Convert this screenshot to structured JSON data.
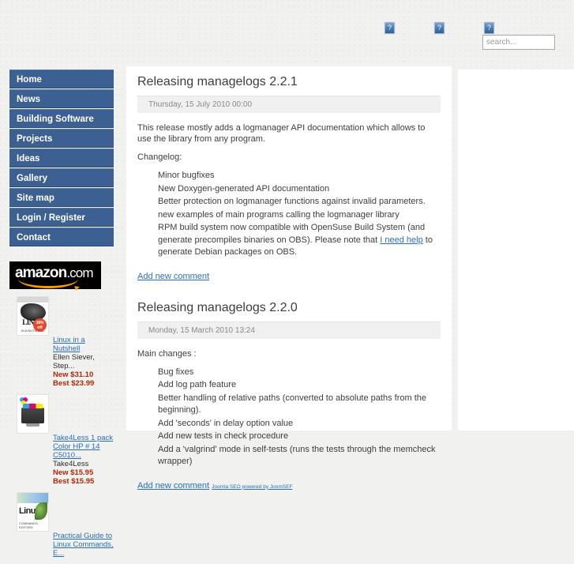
{
  "header": {
    "broken_images": [
      {
        "name": "broken-image-icon-1",
        "glyph": "?"
      },
      {
        "name": "broken-image-icon-2",
        "glyph": "?"
      },
      {
        "name": "broken-image-icon-3",
        "glyph": "?"
      }
    ],
    "search": {
      "placeholder": "search...",
      "value": ""
    }
  },
  "sidebar": {
    "menu": [
      {
        "label": "Home"
      },
      {
        "label": "News"
      },
      {
        "label": "Building Software"
      },
      {
        "label": "Projects"
      },
      {
        "label": "Ideas"
      },
      {
        "label": "Gallery"
      },
      {
        "label": "Site map"
      },
      {
        "label": "Login / Register"
      },
      {
        "label": "Contact"
      }
    ],
    "amazon": {
      "logo_text": "amazon",
      "logo_suffix": ".com",
      "products": [
        {
          "title": "Linux in a Nutshell",
          "author": "Ellen Siever, Step...",
          "price_new": "New $31.10",
          "price_best": "Best $23.99",
          "cover_title": "LINUX",
          "cover_sub": "IN A NUTSHELL",
          "badge": "38% off"
        },
        {
          "title": "Take4Less 1 pack Color HP # 14 C5010...",
          "author": "Take4Less",
          "price_new": "New $15.95",
          "price_best": "Best $15.95",
          "cover_title": "",
          "cover_sub": "",
          "badge": ""
        },
        {
          "title": "Practical Guide to Linux Commands, E...",
          "author": "",
          "price_new": "",
          "price_best": "",
          "cover_title": "Linux",
          "cover_sub": "COMMANDS, EDITORS",
          "badge": ""
        }
      ]
    }
  },
  "main": {
    "articles": [
      {
        "title": "Releasing managelogs 2.2.1",
        "date": "Thursday, 15 July 2010 00:00",
        "intro": "This release mostly adds a logmanager API documentation which allows to use the library from any program.",
        "list_label": "Changelog:",
        "items": [
          "Minor bugfixes",
          "New Doxygen-generated API documentation",
          "Better protection on logmanager functions against invalid parameters.",
          "new examples of main programs calling the logmanager library"
        ],
        "last_item_pre": "RPM build system now compatible with OpenSuse Build System (and generate precompiles binaries on OBS). Please note that ",
        "last_item_link": "I need help",
        "last_item_post": " to generate Debian packages on OBS.",
        "comment_link": "Add new comment"
      },
      {
        "title": "Releasing managelogs 2.2.0",
        "date": "Monday, 15 March 2010 13:24",
        "intro": "",
        "list_label": "Main changes :",
        "items": [
          "Bug fixes",
          "Add log path feature",
          "Better handling of relative paths (converted to absolute paths from the beginning).",
          "Add 'seconds' in delay option value",
          "Add new tests in check procedure",
          "Add a 'valgrind' mode in self-tests (runs the tests through the memcheck wrapper)"
        ],
        "comment_link": "Add new comment"
      }
    ],
    "footer_credit": "Joomla SEO powered by JoomSEF"
  },
  "colors": {
    "menu_blue": "#3d6093",
    "link_blue": "#2a6ebb",
    "price_red": "#b12704",
    "amazon_orange": "#ff9900",
    "page_bg": "#f1f1f0",
    "content_bg": "#ffffff"
  }
}
